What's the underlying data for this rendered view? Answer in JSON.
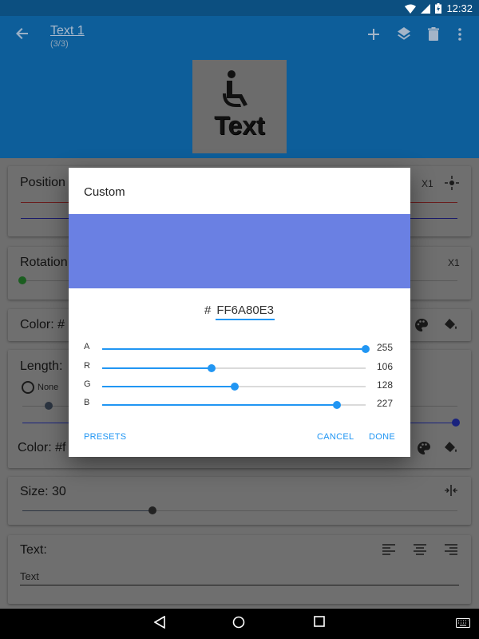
{
  "status": {
    "time": "12:32"
  },
  "appbar": {
    "title": "Text 1",
    "subtitle": "(3/3)"
  },
  "preview": {
    "text": "Text"
  },
  "cards": {
    "position": {
      "label": "Position",
      "multiplier": "X1"
    },
    "rotation": {
      "label": "Rotation",
      "multiplier": "X1"
    },
    "color1": {
      "label": "Color: #"
    },
    "length": {
      "label": "Length:",
      "option_none": "None"
    },
    "color2": {
      "label": "Color: #f"
    },
    "size": {
      "label": "Size: 30",
      "value": 30
    },
    "text": {
      "label": "Text:",
      "value": "Text"
    }
  },
  "dialog": {
    "title": "Custom",
    "color": "#6A80E3",
    "hash": "#",
    "hex_value": "FF6A80E3",
    "sliders": [
      {
        "label": "A",
        "value": 255,
        "max": 255
      },
      {
        "label": "R",
        "value": 106,
        "max": 255
      },
      {
        "label": "G",
        "value": 128,
        "max": 255
      },
      {
        "label": "B",
        "value": 227,
        "max": 255
      }
    ],
    "buttons": {
      "presets": "PRESETS",
      "cancel": "CANCEL",
      "done": "DONE"
    }
  },
  "colors": {
    "accent": "#2196f3",
    "appbar": "#0d5e9a"
  }
}
